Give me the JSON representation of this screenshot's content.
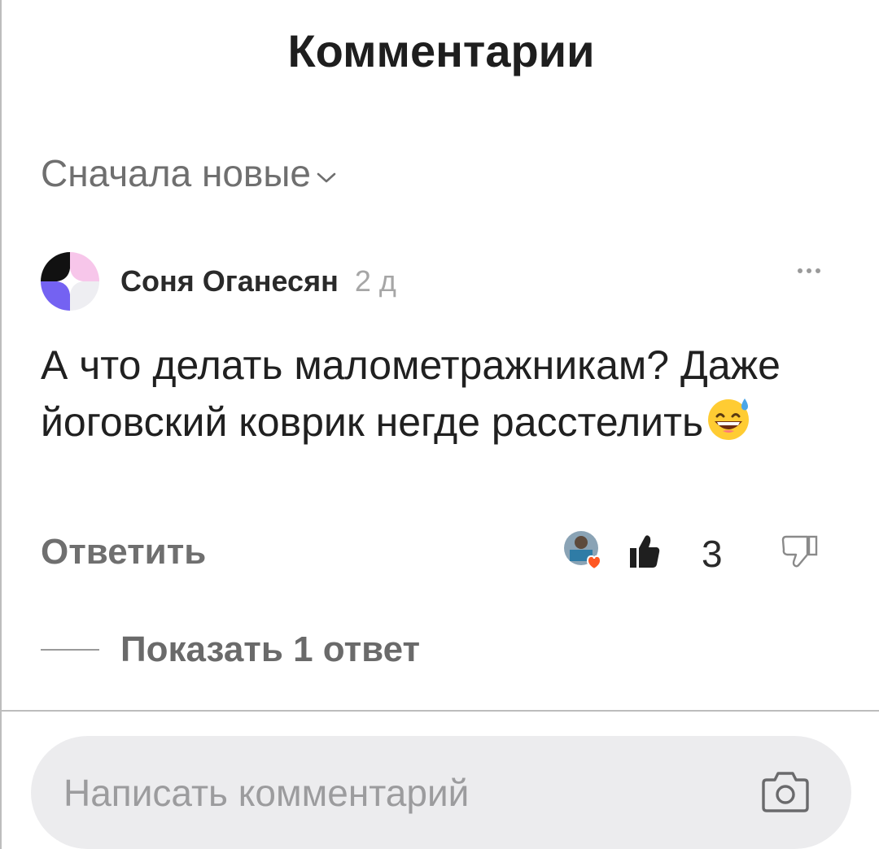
{
  "header": {
    "title": "Комментарии"
  },
  "sort": {
    "label": "Сначала новые"
  },
  "comment": {
    "author": "Соня Оганесян",
    "time": "2 д",
    "text": "А что делать малометражникам? Даже йоговский коврик негде расстелить",
    "reply_label": "Ответить",
    "like_count": "3",
    "show_replies_label": "Показать 1 ответ"
  },
  "composer": {
    "placeholder": "Написать комментарий"
  },
  "icons": {
    "sort": "chevron-down-icon",
    "more": "more-dots-icon",
    "like": "thumbs-up-icon",
    "dislike": "thumbs-down-icon",
    "camera": "camera-icon",
    "emoji": "grinning-sweat-emoji"
  },
  "colors": {
    "background": "#ffffff",
    "muted": "#6f6f6f",
    "input_bg": "#ececee",
    "reaction_heart": "#ff5722"
  }
}
